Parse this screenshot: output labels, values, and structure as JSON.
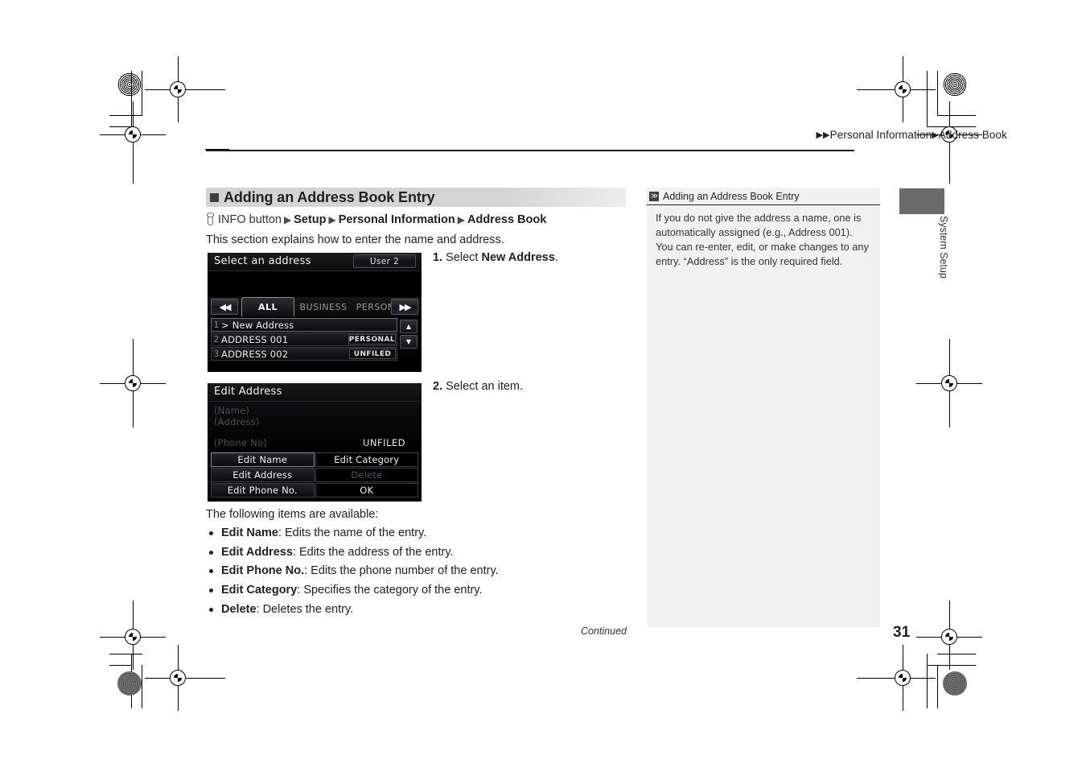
{
  "breadcrumb": {
    "part1": "Personal Information",
    "part2": "Address Book",
    "triangle": "▶"
  },
  "section": {
    "title": "Adding an Address Book Entry"
  },
  "nav_path": {
    "button_label": "INFO button",
    "step1": "Setup",
    "step2": "Personal Information",
    "step3": "Address Book",
    "triangle": "▶"
  },
  "intro": "This section explains how to enter the name and address.",
  "device1": {
    "title": "Select an address",
    "user_button": "User 2",
    "tab_prev": "◀◀",
    "tab_next": "▶▶",
    "tabs": [
      {
        "label": "ALL",
        "active": true
      },
      {
        "label": "BUSINESS",
        "active": false
      },
      {
        "label": "PERSONAL",
        "active": false
      }
    ],
    "rows": [
      {
        "num": "1",
        "name": "> New Address",
        "badge": ""
      },
      {
        "num": "2",
        "name": "ADDRESS 001",
        "badge": "PERSONAL"
      },
      {
        "num": "3",
        "name": "ADDRESS 002",
        "badge": "UNFILED"
      }
    ],
    "scroll_up": "▲",
    "scroll_down": "▼"
  },
  "device2": {
    "title": "Edit Address",
    "field_name": "(Name)",
    "field_address": "(Address)",
    "field_phone": "(Phone No)",
    "category_value": "UNFILED",
    "buttons": [
      {
        "label": "Edit Name",
        "state": "highlighted"
      },
      {
        "label": "Edit Category",
        "state": "normal"
      },
      {
        "label": "Edit Address",
        "state": "normal"
      },
      {
        "label": "Delete",
        "state": "disabled"
      },
      {
        "label": "Edit Phone No.",
        "state": "normal"
      },
      {
        "label": "OK",
        "state": "normal"
      }
    ]
  },
  "steps": {
    "step1_num": "1.",
    "step1_pre": "Select ",
    "step1_bold": "New Address",
    "step1_post": ".",
    "step2_num": "2.",
    "step2_text": "Select an item."
  },
  "items": {
    "lead": "The following items are available:",
    "list": [
      {
        "term": "Edit Name",
        "desc": ": Edits the name of the entry."
      },
      {
        "term": "Edit Address",
        "desc": ": Edits the address of the entry."
      },
      {
        "term": "Edit Phone No.",
        "desc": ": Edits the phone number of the entry."
      },
      {
        "term": "Edit Category",
        "desc": ": Specifies the category of the entry."
      },
      {
        "term": "Delete",
        "desc": ": Deletes the entry."
      }
    ]
  },
  "note": {
    "chevron": "≫",
    "title": "Adding an Address Book Entry",
    "body": "If you do not give the address a name, one is automatically assigned (e.g., Address 001). You can re-enter, edit, or make changes to any entry. “Address” is the only required field."
  },
  "side_tab": {
    "label": "System Setup"
  },
  "footer": {
    "continued": "Continued",
    "page_number": "31"
  },
  "colors": {
    "section_band": "#d4d4d4",
    "note_bg": "#f1f1f1",
    "side_tab": "#6b6b6b",
    "text": "#231f20",
    "device_bg": "#000000"
  }
}
